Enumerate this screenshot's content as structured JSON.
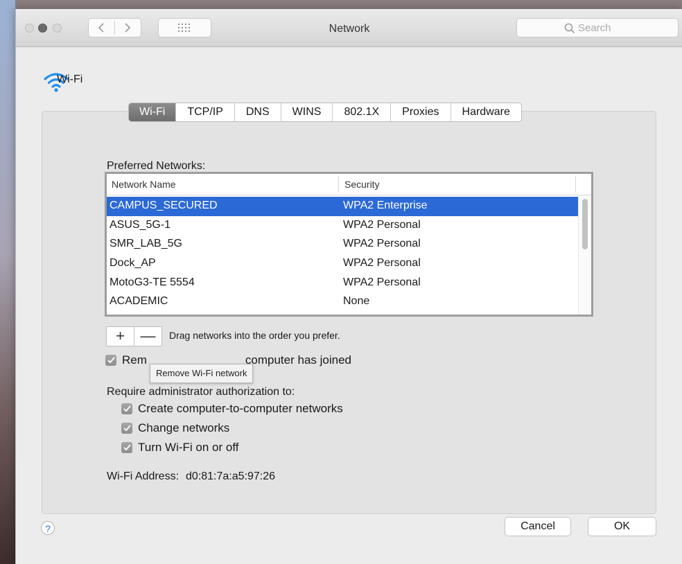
{
  "window": {
    "title": "Network",
    "search_placeholder": "Search"
  },
  "interface": {
    "icon": "wifi-icon",
    "name": "Wi-Fi"
  },
  "tabs": [
    {
      "label": "Wi-Fi",
      "active": true
    },
    {
      "label": "TCP/IP",
      "active": false
    },
    {
      "label": "DNS",
      "active": false
    },
    {
      "label": "WINS",
      "active": false
    },
    {
      "label": "802.1X",
      "active": false
    },
    {
      "label": "Proxies",
      "active": false
    },
    {
      "label": "Hardware",
      "active": false
    }
  ],
  "preferred": {
    "label": "Preferred Networks:",
    "columns": [
      "Network Name",
      "Security"
    ],
    "rows": [
      {
        "name": "CAMPUS_SECURED",
        "security": "WPA2 Enterprise",
        "selected": true
      },
      {
        "name": "ASUS_5G-1",
        "security": "WPA2 Personal"
      },
      {
        "name": "SMR_LAB_5G",
        "security": "WPA2 Personal"
      },
      {
        "name": "Dock_AP",
        "security": "WPA2 Personal"
      },
      {
        "name": "MotoG3-TE 5554",
        "security": "WPA2 Personal"
      },
      {
        "name": "ACADEMIC",
        "security": "None"
      }
    ],
    "add_label": "+",
    "remove_label": "—",
    "hint": "Drag networks into the order you prefer."
  },
  "options": {
    "remember_label": "Rem",
    "remember_tail": "computer has joined",
    "tooltip": "Remove Wi-Fi network",
    "require_label": "Require administrator authorization to:",
    "require_items": [
      "Create computer-to-computer networks",
      "Change networks",
      "Turn Wi-Fi on or off"
    ]
  },
  "address": {
    "label": "Wi-Fi Address:",
    "value": "d0:81:7a:a5:97:26"
  },
  "footer": {
    "help": "?",
    "cancel": "Cancel",
    "ok": "OK"
  },
  "colors": {
    "selection": "#2b69d6",
    "wifi_icon": "#1e8ff0"
  }
}
